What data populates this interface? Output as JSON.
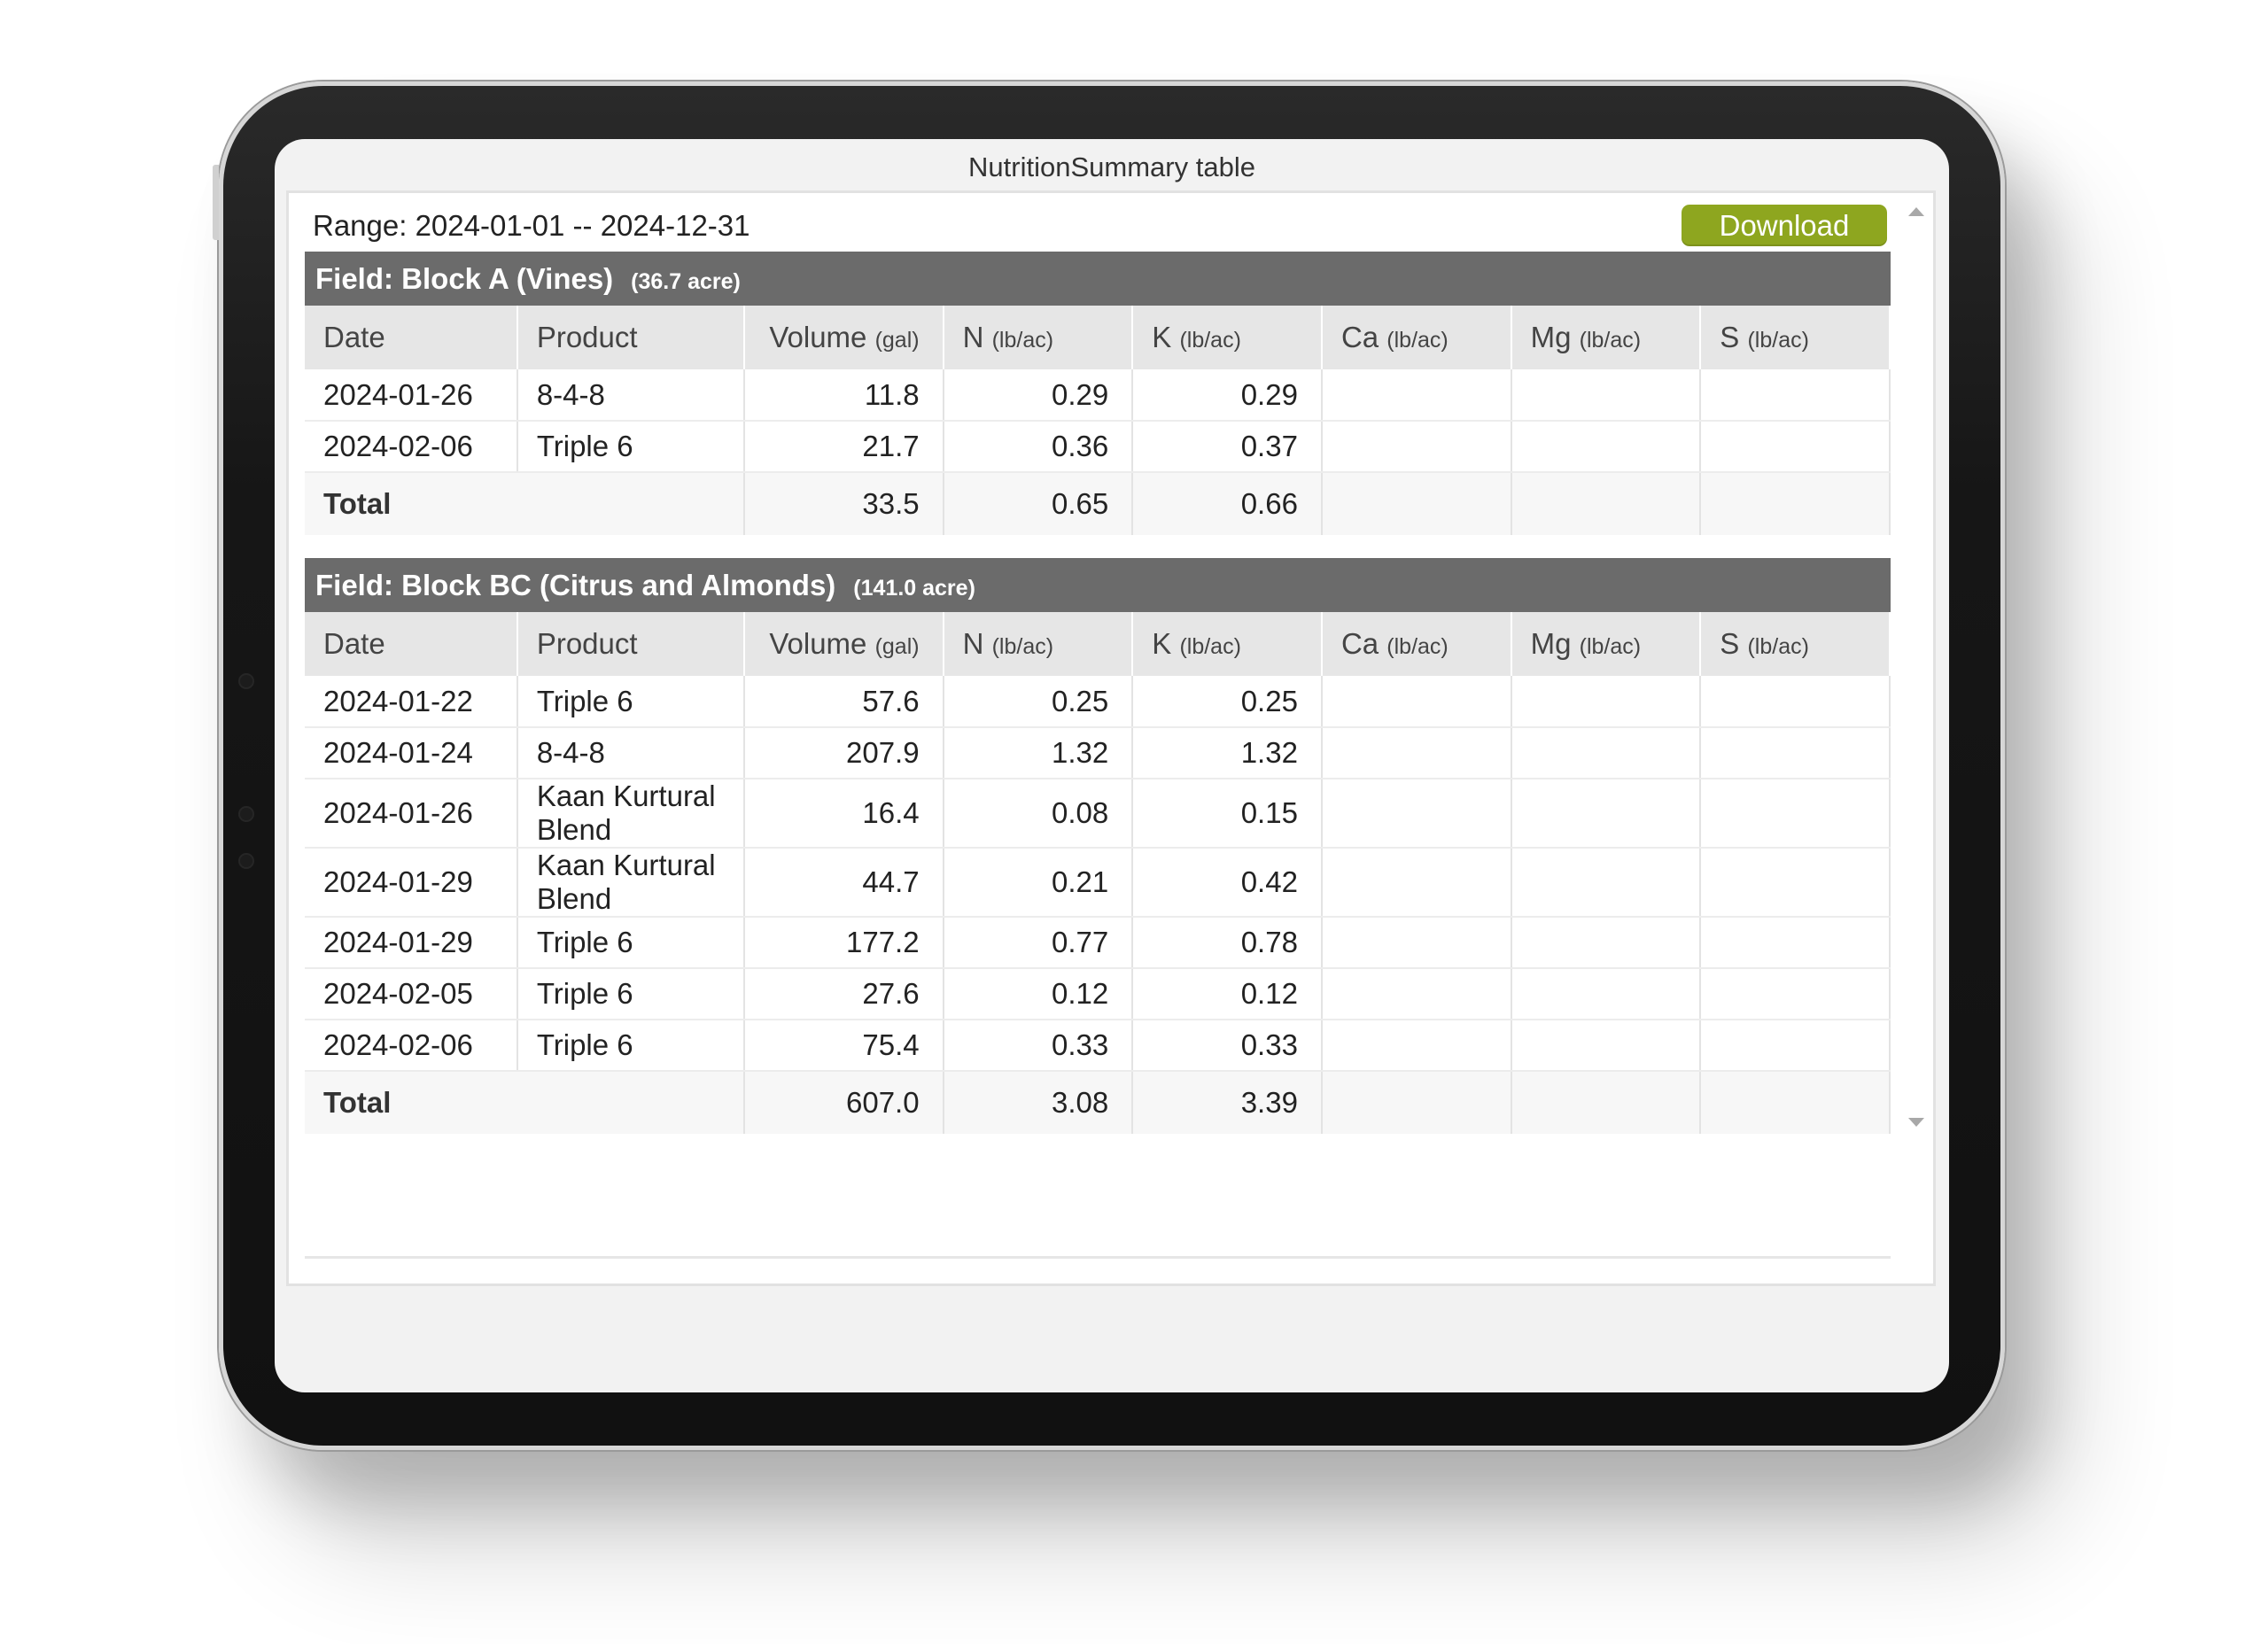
{
  "panel_title": "NutritionSummary table",
  "range_label": "Range: 2024-01-01 -- 2024-12-31",
  "download_label": "Download",
  "columns": {
    "date": "Date",
    "product": "Product",
    "volume": "Volume",
    "volume_unit": "(gal)",
    "n": "N",
    "k": "K",
    "ca": "Ca",
    "mg": "Mg",
    "s": "S",
    "nutrient_unit": "(lb/ac)"
  },
  "total_label": "Total",
  "fields": [
    {
      "name": "Field: Block A (Vines)",
      "acre": "(36.7 acre)",
      "rows": [
        {
          "date": "2024-01-26",
          "product": "8-4-8",
          "volume": "11.8",
          "n": "0.29",
          "k": "0.29",
          "ca": "",
          "mg": "",
          "s": ""
        },
        {
          "date": "2024-02-06",
          "product": "Triple 6",
          "volume": "21.7",
          "n": "0.36",
          "k": "0.37",
          "ca": "",
          "mg": "",
          "s": ""
        }
      ],
      "total": {
        "volume": "33.5",
        "n": "0.65",
        "k": "0.66",
        "ca": "",
        "mg": "",
        "s": ""
      }
    },
    {
      "name": "Field: Block BC (Citrus and Almonds)",
      "acre": "(141.0 acre)",
      "rows": [
        {
          "date": "2024-01-22",
          "product": "Triple 6",
          "volume": "57.6",
          "n": "0.25",
          "k": "0.25",
          "ca": "",
          "mg": "",
          "s": ""
        },
        {
          "date": "2024-01-24",
          "product": "8-4-8",
          "volume": "207.9",
          "n": "1.32",
          "k": "1.32",
          "ca": "",
          "mg": "",
          "s": ""
        },
        {
          "date": "2024-01-26",
          "product": "Kaan Kurtural Blend",
          "volume": "16.4",
          "n": "0.08",
          "k": "0.15",
          "ca": "",
          "mg": "",
          "s": ""
        },
        {
          "date": "2024-01-29",
          "product": "Kaan Kurtural Blend",
          "volume": "44.7",
          "n": "0.21",
          "k": "0.42",
          "ca": "",
          "mg": "",
          "s": ""
        },
        {
          "date": "2024-01-29",
          "product": "Triple 6",
          "volume": "177.2",
          "n": "0.77",
          "k": "0.78",
          "ca": "",
          "mg": "",
          "s": ""
        },
        {
          "date": "2024-02-05",
          "product": "Triple 6",
          "volume": "27.6",
          "n": "0.12",
          "k": "0.12",
          "ca": "",
          "mg": "",
          "s": ""
        },
        {
          "date": "2024-02-06",
          "product": "Triple 6",
          "volume": "75.4",
          "n": "0.33",
          "k": "0.33",
          "ca": "",
          "mg": "",
          "s": ""
        }
      ],
      "total": {
        "volume": "607.0",
        "n": "3.08",
        "k": "3.39",
        "ca": "",
        "mg": "",
        "s": ""
      }
    }
  ],
  "colors": {
    "accent": "#8ea61f",
    "field_header": "#6b6b6b",
    "column_header": "#e6e6e6"
  },
  "icons": {
    "scroll_up": "triangle-up-icon",
    "scroll_down": "triangle-down-icon"
  }
}
